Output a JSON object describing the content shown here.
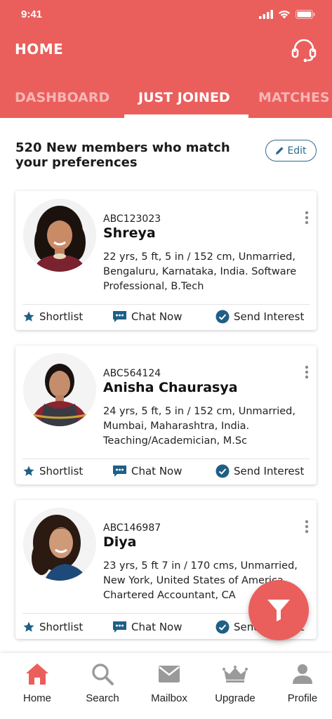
{
  "status_bar": {
    "time": "9:41"
  },
  "header": {
    "title": "HOME"
  },
  "tabs": [
    {
      "label": "DASHBOARD",
      "active": false
    },
    {
      "label": "JUST JOINED",
      "active": true
    },
    {
      "label": "MATCHES",
      "active": false
    }
  ],
  "summary": {
    "text": "520 New members who match your preferences",
    "edit_label": "Edit"
  },
  "profiles": [
    {
      "id": "ABC123023",
      "name": "Shreya",
      "details": "22 yrs, 5 ft, 5 in / 152 cm, Unmarried, Bengaluru, Karnataka, India. Software Professional, B.Tech"
    },
    {
      "id": "ABC564124",
      "name": "Anisha Chaurasya",
      "details": "24 yrs, 5 ft, 5 in / 152 cm, Unmarried, Mumbai, Maharashtra, India. Teaching/Academician, M.Sc"
    },
    {
      "id": "ABC146987",
      "name": "Diya",
      "details": "23 yrs, 5 ft 7 in / 170 cms, Unmarried, New York, United States of America. Chartered Accountant, CA"
    }
  ],
  "card_actions": {
    "shortlist": "Shortlist",
    "chat": "Chat Now",
    "interest": "Send Interest"
  },
  "bottom_nav": [
    {
      "label": "Home",
      "icon": "home-icon",
      "active": true
    },
    {
      "label": "Search",
      "icon": "search-icon",
      "active": false
    },
    {
      "label": "Mailbox",
      "icon": "mail-icon",
      "active": false
    },
    {
      "label": "Upgrade",
      "icon": "crown-icon",
      "active": false
    },
    {
      "label": "Profile",
      "icon": "person-icon",
      "active": false
    }
  ],
  "colors": {
    "brand": "#ea5e5c",
    "accent": "#2b6a8e",
    "icon_inactive": "#9a9a9a"
  }
}
